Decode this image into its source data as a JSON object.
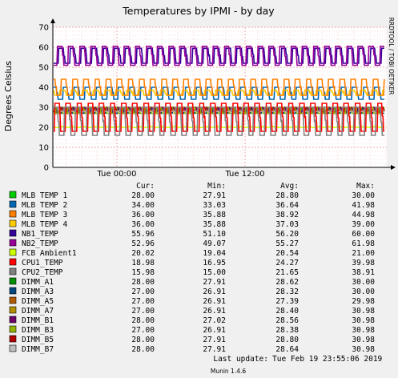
{
  "chart_data": {
    "type": "line",
    "title": "Temperatures by IPMI - by day",
    "ylabel": "Degrees Celsius",
    "watermark": "RRDTOOL / TOBI OETIKER",
    "ylim": [
      0,
      70
    ],
    "y_ticks": [
      "0",
      "10",
      "20",
      "30",
      "40",
      "50",
      "60",
      "70"
    ],
    "x_ticks": [
      "Tue 00:00",
      "Tue 12:00"
    ],
    "grid": true,
    "legend_placement": "bottom",
    "column_headers": {
      "cur": "Cur:",
      "min": "Min:",
      "avg": "Avg:",
      "max": "Max:"
    },
    "series": [
      {
        "name": "MLB TEMP 1",
        "color": "#00cc00",
        "cur": "28.00",
        "min": "27.91",
        "avg": "28.80",
        "max": "30.00",
        "mode": "square",
        "low": 28,
        "high": 30
      },
      {
        "name": "MLB TEMP 2",
        "color": "#0066b3",
        "cur": "34.00",
        "min": "33.03",
        "avg": "36.64",
        "max": "41.98",
        "mode": "square",
        "low": 34,
        "high": 40
      },
      {
        "name": "MLB TEMP 3",
        "color": "#ff8000",
        "cur": "36.00",
        "min": "35.88",
        "avg": "38.92",
        "max": "44.98",
        "mode": "square",
        "low": 36,
        "high": 44
      },
      {
        "name": "MLB TEMP 4",
        "color": "#ffcc00",
        "cur": "36.00",
        "min": "35.88",
        "avg": "37.03",
        "max": "39.00",
        "mode": "square",
        "low": 36,
        "high": 38.5
      },
      {
        "name": "NB1_TEMP",
        "color": "#330099",
        "cur": "55.96",
        "min": "51.10",
        "avg": "56.20",
        "max": "60.00",
        "mode": "square",
        "low": 52,
        "high": 59.5
      },
      {
        "name": "NB2_TEMP",
        "color": "#990099",
        "cur": "52.96",
        "min": "49.07",
        "avg": "55.27",
        "max": "61.98",
        "mode": "square",
        "low": 51,
        "high": 60.5
      },
      {
        "name": "FCB Ambient1",
        "color": "#ccff00",
        "cur": "20.02",
        "min": "19.04",
        "avg": "20.54",
        "max": "21.00",
        "mode": "flat",
        "low": 20,
        "high": 21
      },
      {
        "name": "CPU1_TEMP",
        "color": "#ff0000",
        "cur": "18.98",
        "min": "16.95",
        "avg": "24.27",
        "max": "39.98",
        "mode": "square",
        "low": 18,
        "high": 32
      },
      {
        "name": "CPU2_TEMP",
        "color": "#808080",
        "cur": "15.98",
        "min": "15.00",
        "avg": "21.65",
        "max": "38.91",
        "mode": "square",
        "low": 16,
        "high": 30
      },
      {
        "name": "DIMM_A1",
        "color": "#008f00",
        "cur": "28.00",
        "min": "27.91",
        "avg": "28.62",
        "max": "30.00",
        "mode": "square",
        "low": 28,
        "high": 29.5
      },
      {
        "name": "DIMM_A3",
        "color": "#00487d",
        "cur": "27.00",
        "min": "26.91",
        "avg": "28.32",
        "max": "30.00",
        "mode": "square",
        "low": 27,
        "high": 29.5
      },
      {
        "name": "DIMM_A5",
        "color": "#b35a00",
        "cur": "27.00",
        "min": "26.91",
        "avg": "27.39",
        "max": "29.98",
        "mode": "square",
        "low": 27,
        "high": 28.5
      },
      {
        "name": "DIMM_A7",
        "color": "#b38f00",
        "cur": "27.00",
        "min": "26.91",
        "avg": "28.40",
        "max": "30.98",
        "mode": "square",
        "low": 27,
        "high": 30
      },
      {
        "name": "DIMM_B1",
        "color": "#6b006b",
        "cur": "28.00",
        "min": "27.02",
        "avg": "28.56",
        "max": "30.98",
        "mode": "square",
        "low": 28,
        "high": 30
      },
      {
        "name": "DIMM_B3",
        "color": "#8fb300",
        "cur": "27.00",
        "min": "26.91",
        "avg": "28.38",
        "max": "30.98",
        "mode": "square",
        "low": 27,
        "high": 30
      },
      {
        "name": "DIMM_B5",
        "color": "#b30000",
        "cur": "28.00",
        "min": "27.91",
        "avg": "28.80",
        "max": "30.98",
        "mode": "square",
        "low": 28,
        "high": 30
      },
      {
        "name": "DIMM_B7",
        "color": "#bebebe",
        "cur": "28.00",
        "min": "27.91",
        "avg": "28.64",
        "max": "30.98",
        "mode": "square",
        "low": 28,
        "high": 30
      }
    ],
    "last_update_label": "Last update:",
    "last_update_value": "Tue Feb 19 23:55:06 2019",
    "footer": "Munin 1.4.6"
  }
}
